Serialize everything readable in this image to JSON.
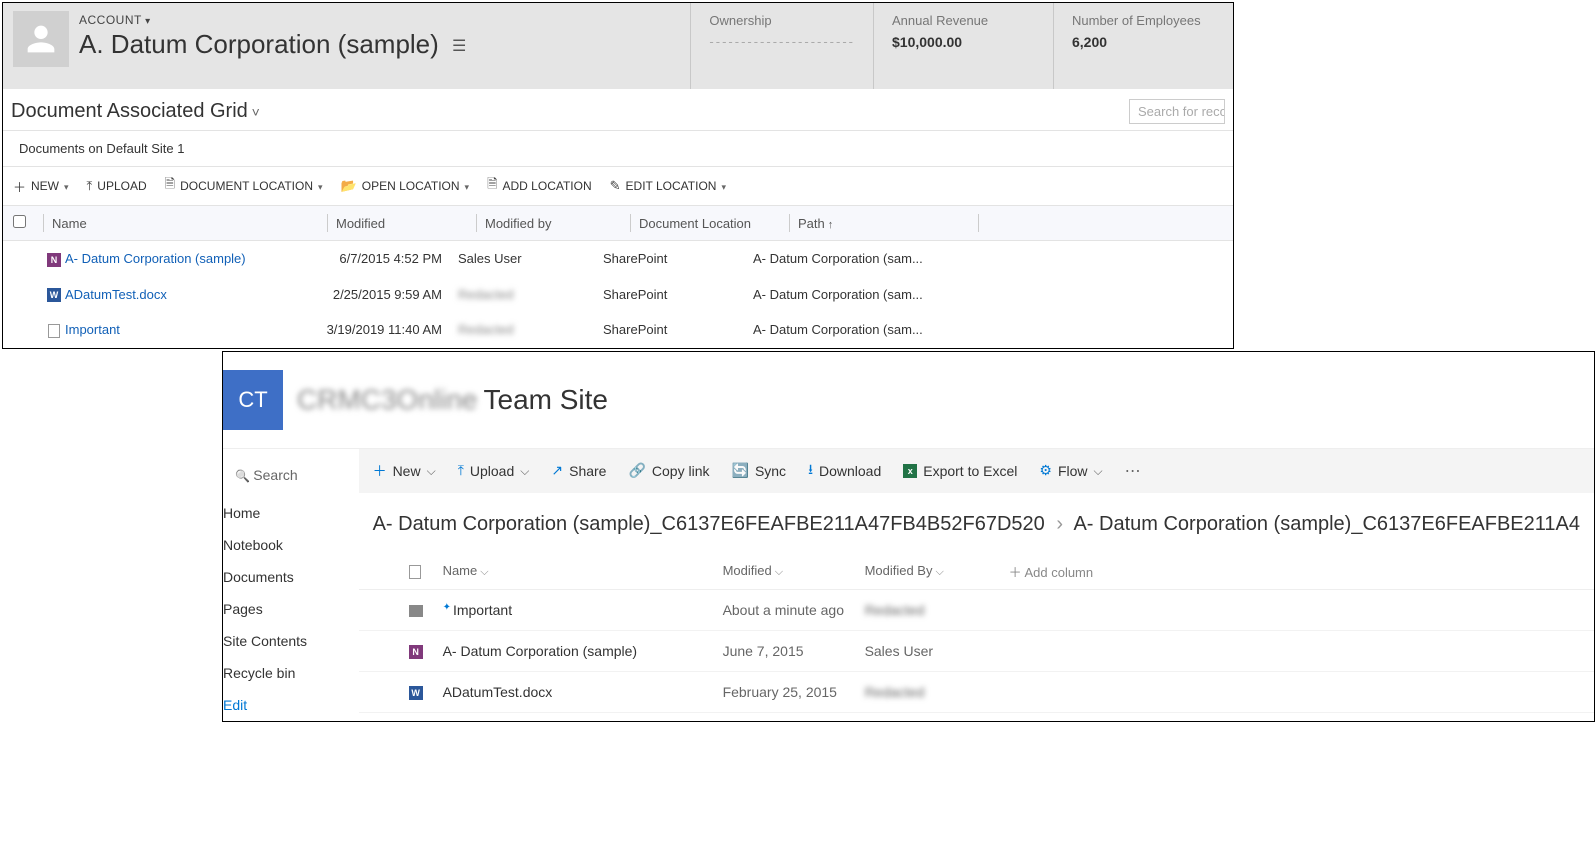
{
  "crm": {
    "account_label": "ACCOUNT",
    "account_name": "A. Datum Corporation (sample)",
    "stats": {
      "ownership": {
        "label": "Ownership",
        "value": "-----------------------"
      },
      "revenue": {
        "label": "Annual Revenue",
        "value": "$10,000.00"
      },
      "employees": {
        "label": "Number of Employees",
        "value": "6,200"
      }
    },
    "section_title": "Document Associated Grid",
    "search_placeholder": "Search for reco",
    "breadcrumb": "Documents on Default Site 1",
    "toolbar": {
      "new": "NEW",
      "upload": "UPLOAD",
      "doc_loc": "DOCUMENT LOCATION",
      "open_loc": "OPEN LOCATION",
      "add_loc": "ADD LOCATION",
      "edit_loc": "EDIT LOCATION"
    },
    "columns": {
      "name": "Name",
      "modified": "Modified",
      "modified_by": "Modified by",
      "location": "Document Location",
      "path": "Path"
    },
    "rows": [
      {
        "icon": "onenote",
        "name": "A- Datum Corporation (sample)",
        "modified": "6/7/2015 4:52 PM",
        "modified_by": "Sales User",
        "modified_by_blur": false,
        "location": "SharePoint",
        "path": "A- Datum Corporation (sam..."
      },
      {
        "icon": "word",
        "name": "ADatumTest.docx",
        "modified": "2/25/2015 9:59 AM",
        "modified_by": "Redacted",
        "modified_by_blur": true,
        "location": "SharePoint",
        "path": "A- Datum Corporation (sam..."
      },
      {
        "icon": "file",
        "name": "Important",
        "modified": "3/19/2019 11:40 AM",
        "modified_by": "Redacted",
        "modified_by_blur": true,
        "location": "SharePoint",
        "path": "A- Datum Corporation (sam..."
      }
    ]
  },
  "sp": {
    "logo_text": "CT",
    "site_name_blur": "CRMC3Online",
    "site_name": "Team Site",
    "search": "Search",
    "nav": {
      "home": "Home",
      "notebook": "Notebook",
      "documents": "Documents",
      "pages": "Pages",
      "contents": "Site Contents",
      "recycle": "Recycle bin",
      "edit": "Edit"
    },
    "cmd": {
      "new": "New",
      "upload": "Upload",
      "share": "Share",
      "copy": "Copy link",
      "sync": "Sync",
      "download": "Download",
      "excel": "Export to Excel",
      "flow": "Flow"
    },
    "breadcrumb": {
      "part1": "A- Datum Corporation (sample)_C6137E6FEAFBE211A47FB4B52F67D520",
      "part2": "A- Datum Corporation (sample)_C6137E6FEAFBE211A4"
    },
    "columns": {
      "name": "Name",
      "modified": "Modified",
      "modified_by": "Modified By",
      "add": "Add column"
    },
    "rows": [
      {
        "icon": "folder",
        "shared": true,
        "name": "Important",
        "modified": "About a minute ago",
        "modified_by": "Redacted",
        "modified_by_blur": true
      },
      {
        "icon": "onenote",
        "shared": false,
        "name": "A- Datum Corporation (sample)",
        "modified": "June 7, 2015",
        "modified_by": "Sales User",
        "modified_by_blur": false
      },
      {
        "icon": "word",
        "shared": false,
        "name": "ADatumTest.docx",
        "modified": "February 25, 2015",
        "modified_by": "Redacted",
        "modified_by_blur": true
      }
    ]
  }
}
